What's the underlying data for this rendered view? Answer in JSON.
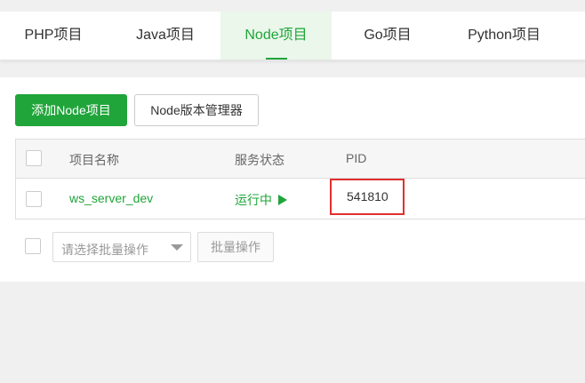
{
  "tabs": [
    {
      "label": "PHP项目",
      "active": false
    },
    {
      "label": "Java项目",
      "active": false
    },
    {
      "label": "Node项目",
      "active": true
    },
    {
      "label": "Go项目",
      "active": false
    },
    {
      "label": "Python项目",
      "active": false
    }
  ],
  "toolbar": {
    "add_label": "添加Node项目",
    "version_manager_label": "Node版本管理器"
  },
  "table": {
    "headers": {
      "name": "项目名称",
      "status": "服务状态",
      "pid": "PID"
    },
    "rows": [
      {
        "name": "ws_server_dev",
        "status": "运行中",
        "status_icon": "play-icon",
        "pid": "541810"
      }
    ]
  },
  "batch": {
    "select_placeholder": "请选择批量操作",
    "button_label": "批量操作"
  },
  "colors": {
    "accent": "#20a53a",
    "highlight_border": "#e0302f",
    "page_bg": "#f0f0f0"
  }
}
